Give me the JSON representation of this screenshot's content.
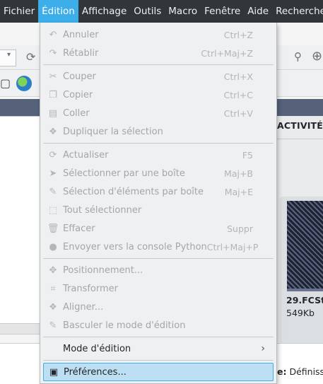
{
  "menubar": {
    "items": [
      "Fichier",
      "Édition",
      "Affichage",
      "Outils",
      "Macro",
      "Fenêtre",
      "Aide",
      "Rechercher"
    ],
    "active_index": 1
  },
  "edit_menu": {
    "groups": [
      [
        {
          "label": "Annuler",
          "shortcut": "Ctrl+Z",
          "icon": "undo-icon"
        },
        {
          "label": "Rétablir",
          "shortcut": "Ctrl+Maj+Z",
          "icon": "redo-icon"
        }
      ],
      [
        {
          "label": "Couper",
          "shortcut": "Ctrl+X",
          "icon": "scissors-icon"
        },
        {
          "label": "Copier",
          "shortcut": "Ctrl+C",
          "icon": "copy-icon"
        },
        {
          "label": "Coller",
          "shortcut": "Ctrl+V",
          "icon": "paste-icon"
        },
        {
          "label": "Dupliquer la sélection",
          "shortcut": "",
          "icon": "duplicate-icon"
        }
      ],
      [
        {
          "label": "Actualiser",
          "shortcut": "F5",
          "icon": "refresh-icon"
        },
        {
          "label": "Sélectionner par une boîte",
          "shortcut": "Maj+B",
          "icon": "pointer-icon"
        },
        {
          "label": "Sélection d'éléments par boîte",
          "shortcut": "Maj+E",
          "icon": "pencil-icon"
        },
        {
          "label": "Tout sélectionner",
          "shortcut": "",
          "icon": "select-all-icon"
        },
        {
          "label": "Effacer",
          "shortcut": "Suppr",
          "icon": "trash-icon"
        },
        {
          "label": "Envoyer vers la console Python",
          "shortcut": "Ctrl+Maj+P",
          "icon": "python-icon"
        }
      ],
      [
        {
          "label": "Positionnement...",
          "shortcut": "",
          "icon": "placement-icon"
        },
        {
          "label": "Transformer",
          "shortcut": "",
          "icon": "transform-icon"
        },
        {
          "label": "Aligner...",
          "shortcut": "",
          "icon": "align-icon"
        },
        {
          "label": "Basculer le mode d'édition",
          "shortcut": "",
          "icon": "edit-mode-icon"
        }
      ]
    ],
    "submenu": {
      "label": "Mode d'édition"
    },
    "preferences": {
      "label": "Préférences...",
      "icon": "preferences-icon"
    }
  },
  "background": {
    "activity_header": "ACTIVITÉ",
    "file_name": "29.FCSt",
    "file_size": "549Kb",
    "bottom_text_bold": "e:",
    "bottom_text": " Définiss"
  },
  "colors": {
    "menubar_bg": "#31363b",
    "accent": "#3daee9",
    "highlight_bg": "#bcdff3"
  }
}
